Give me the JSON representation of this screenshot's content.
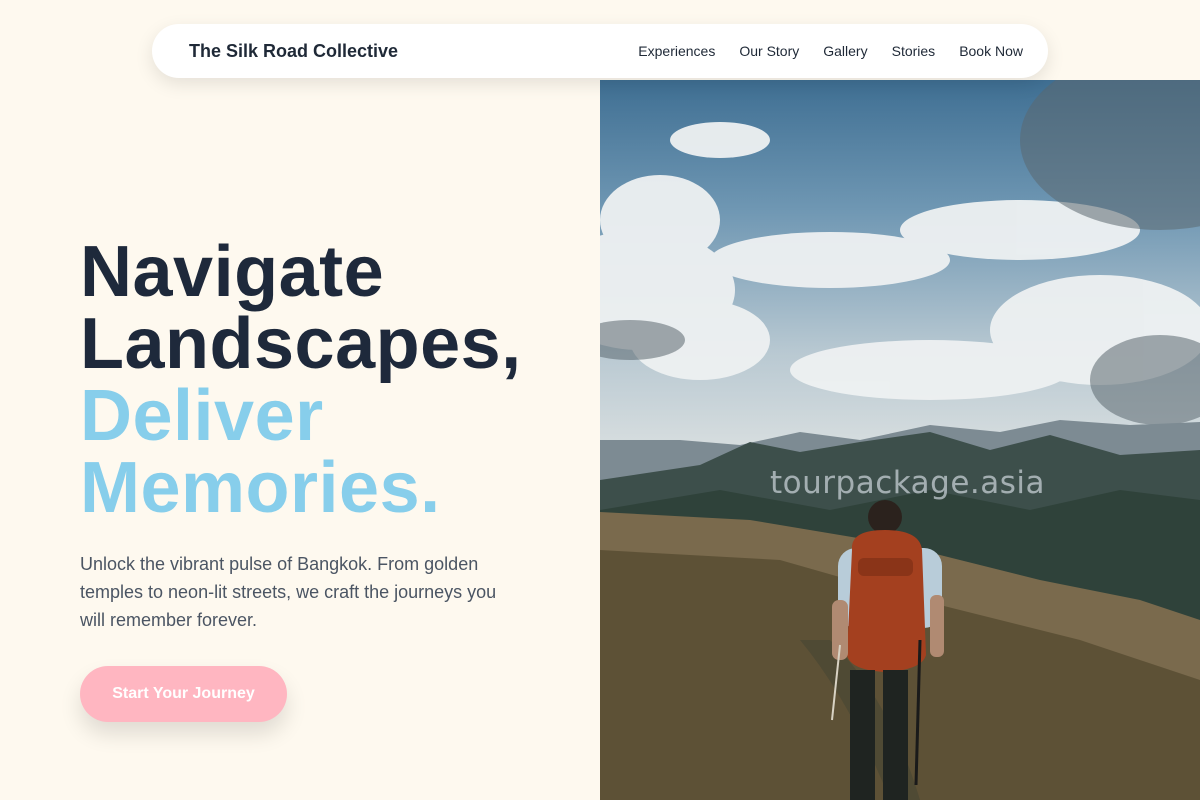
{
  "nav": {
    "brand": "The Silk Road Collective",
    "links": [
      "Experiences",
      "Our Story",
      "Gallery",
      "Stories",
      "Book Now"
    ]
  },
  "hero": {
    "headline_dark": [
      "Navigate",
      "Landscapes,"
    ],
    "headline_light": [
      "Deliver",
      "Memories."
    ],
    "description": "Unlock the vibrant pulse of Bangkok. From golden temples to neon-lit streets, we craft the journeys you will remember forever.",
    "cta_label": "Start Your Journey",
    "image_watermark": "tourpackage.asia"
  },
  "colors": {
    "background": "#fef9ef",
    "headline_dark": "#1e293b",
    "headline_accent": "#87ceeb",
    "cta_background": "#ffb6c1",
    "cta_text": "#ffffff"
  }
}
